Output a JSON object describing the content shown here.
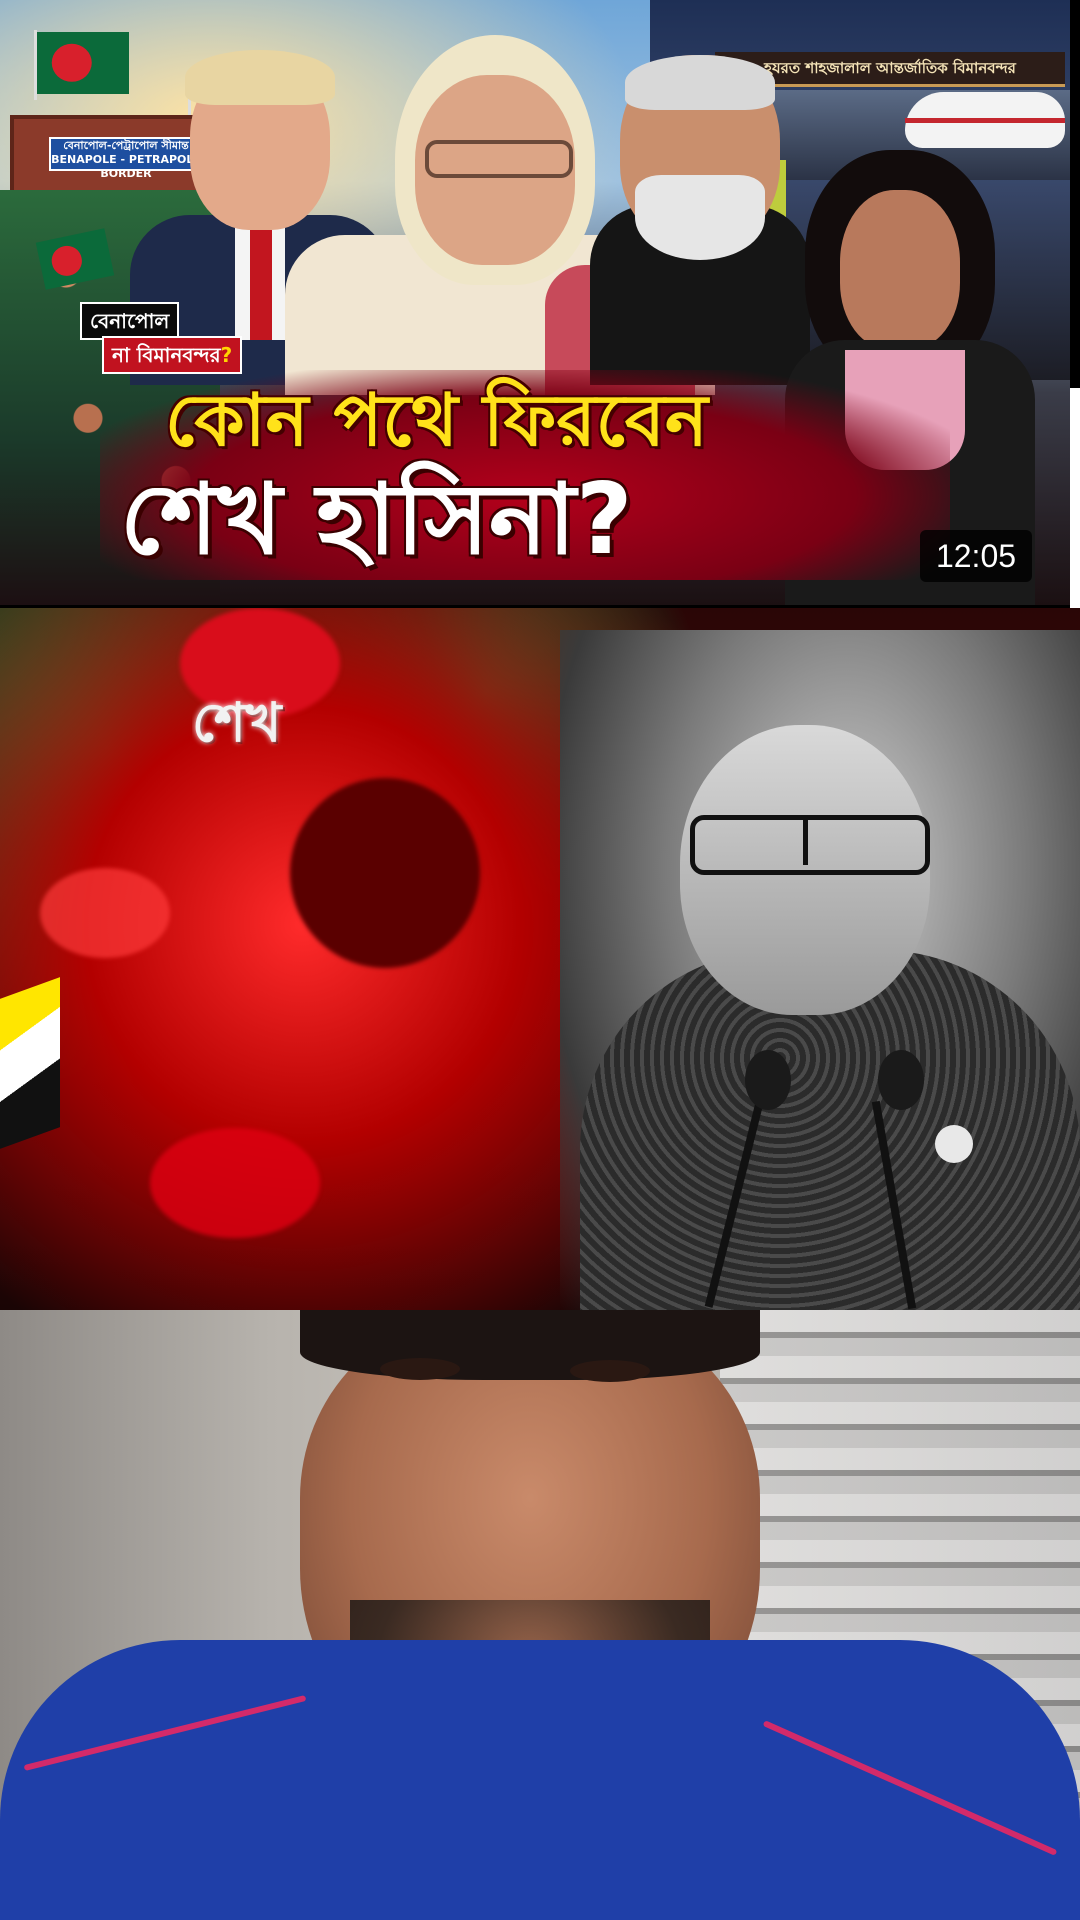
{
  "feed": {
    "thumbnail": {
      "border_sign_line1": "বেনাপোল-পেট্রাপোল সীমান্ত",
      "border_sign_line2": "BENAPOLE - PETRAPOLE BORDER",
      "airport_banner": "হযরত শাহজালাল আন্তর্জাতিক বিমানবন্দর",
      "badge_line1": "বেনাপোল",
      "badge_line2_prefix": "না বিমানবন্দর",
      "badge_line2_mark": "?",
      "headline_line1": "কোন পথে ফিরবেন",
      "headline_line2": "শেখ হাসিনা?",
      "duration": "12:05"
    },
    "video2": {
      "overlay_text": "শেখ"
    }
  },
  "colors": {
    "headline_yellow": "#ffe21a",
    "headline_red_band": "#b3001b",
    "badge_red": "#c1121f",
    "bd_flag_green": "#0b6a3a",
    "bd_flag_red": "#d8202c",
    "shirt_blue": "#1f3fa8"
  }
}
